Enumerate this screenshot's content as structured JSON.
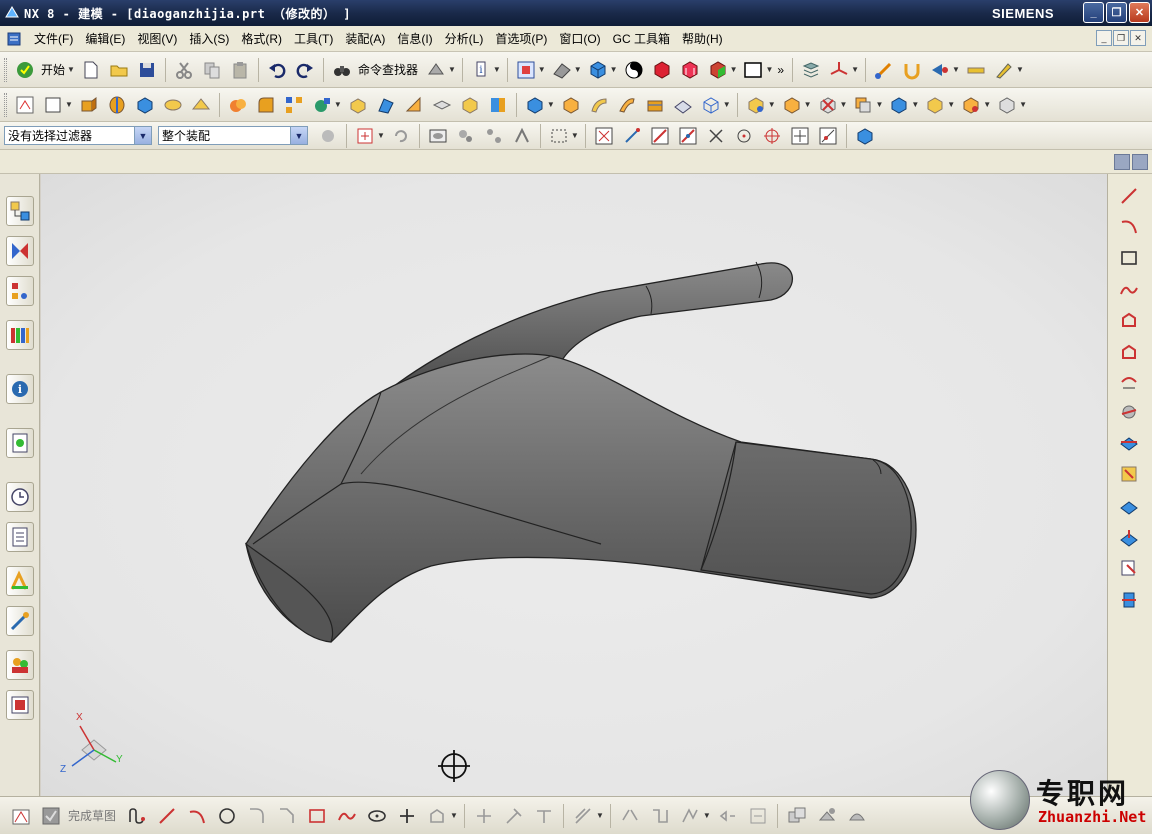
{
  "window": {
    "title": "NX 8 - 建模 - [diaoganzhijia.prt （修改的） ]",
    "brand": "SIEMENS",
    "buttons": {
      "minimize": "_",
      "restore": "❐",
      "close": "✕"
    }
  },
  "menubar": {
    "items": [
      "文件(F)",
      "编辑(E)",
      "视图(V)",
      "插入(S)",
      "格式(R)",
      "工具(T)",
      "装配(A)",
      "信息(I)",
      "分析(L)",
      "首选项(P)",
      "窗口(O)",
      "GC 工具箱",
      "帮助(H)"
    ]
  },
  "toolbar1": {
    "start_label": "开始",
    "command_finder_label": "命令查找器",
    "overflow": "»"
  },
  "toolbar3": {
    "filter_value": "没有选择过滤器",
    "scope_value": "整个装配"
  },
  "bottombar": {
    "finish_sketch_label": "完成草图"
  },
  "triad": {
    "x": "X",
    "y": "Y",
    "z": "Z"
  },
  "watermark": {
    "cn": "专职网",
    "en": "Zhuanzhi.Net"
  },
  "colors": {
    "titlebar": "#1a2a4a",
    "viewport_bg": "#e6e6e6",
    "model_dark": "#4a4a4a",
    "model_light": "#8a8a8a",
    "watermark_red": "#cc0000"
  }
}
